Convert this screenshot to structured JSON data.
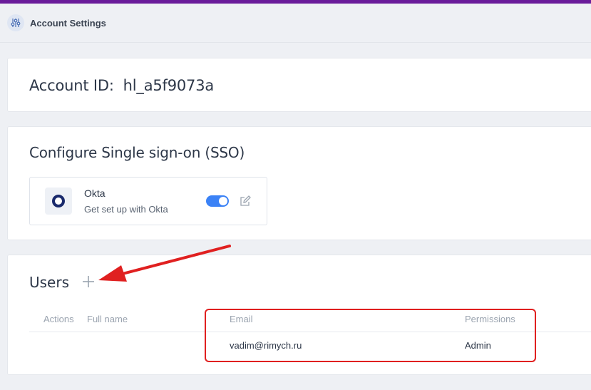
{
  "header": {
    "title": "Account Settings",
    "icon": "sliders-icon"
  },
  "account": {
    "label": "Account ID:",
    "id": "hl_a5f9073a"
  },
  "sso": {
    "title": "Configure Single sign-on (SSO)",
    "provider": {
      "name": "Okta",
      "description": "Get set up with Okta",
      "enabled": true,
      "logo_icon": "okta-logo-icon",
      "edit_icon": "edit-icon"
    }
  },
  "users": {
    "title": "Users",
    "add_icon": "plus-icon",
    "columns": [
      "Actions",
      "Full name",
      "Email",
      "Permissions"
    ],
    "rows": [
      {
        "full_name": "",
        "email": "vadim@rimych.ru",
        "permissions": "Admin"
      }
    ]
  },
  "colors": {
    "accent_bar": "#6a1b9a",
    "toggle_on": "#3b82f6",
    "annotation": "#e02020"
  }
}
